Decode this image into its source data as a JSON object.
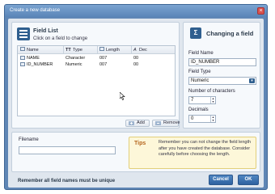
{
  "window": {
    "title": "Create a new database"
  },
  "field_list": {
    "title": "Field List",
    "subtitle": "Click on a field to change",
    "columns": [
      "Name",
      "Type",
      "Length",
      "Dec"
    ],
    "rows": [
      {
        "name": "NAME",
        "type": "Character",
        "length": "007",
        "dec": "00"
      },
      {
        "name": "ID_NUMBER",
        "type": "Numeric",
        "length": "007",
        "dec": "00"
      }
    ],
    "add_label": "Add",
    "remove_label": "Remove"
  },
  "change_field": {
    "title": "Changing a field",
    "field_name_label": "Field Name",
    "field_name_value": "ID_NUMBER",
    "field_type_label": "Field Type",
    "field_type_value": "Numeric",
    "num_chars_label": "Number of characters",
    "num_chars_value": "7",
    "decimals_label": "Decimals",
    "decimals_value": "0"
  },
  "filename": {
    "label": "Filename",
    "value": ""
  },
  "tips": {
    "label": "Tips",
    "text": "Remember you can not change the field length after you have created the database. Consider carefully before choosing the length."
  },
  "footer": {
    "note": "Remember all field names must be unique",
    "cancel_label": "Cancel",
    "ok_label": "OK"
  },
  "colors": {
    "accent": "#2f62a0",
    "titlebar": "#5a85b8",
    "tips_label": "#b5651d"
  }
}
